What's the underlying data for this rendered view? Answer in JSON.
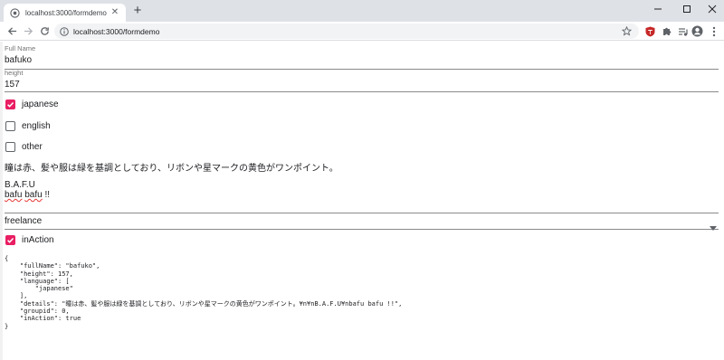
{
  "browser": {
    "tab_title": "localhost:3000/formdemo",
    "url": "localhost:3000/formdemo"
  },
  "form": {
    "full_name": {
      "label": "Full Name",
      "value": "bafuko"
    },
    "height": {
      "label": "height",
      "value": "157"
    },
    "languages": [
      {
        "label": "japanese",
        "checked": true
      },
      {
        "label": "english",
        "checked": false
      },
      {
        "label": "other",
        "checked": false
      }
    ],
    "details_line1": "瞳は赤、髪や服は緑を基調としており、リボンや星マークの黄色がワンポイント。",
    "details_line2": "B.A.F.U",
    "details_word1": "bafu",
    "details_word2": "bafu",
    "details_tail": "!!",
    "group_select": {
      "value": "freelance"
    },
    "in_action": {
      "label": "inAction",
      "checked": true
    }
  },
  "json_output": "{\n    \"fullName\": \"bafuko\",\n    \"height\": 157,\n    \"language\": [\n        \"japanese\"\n    ],\n    \"details\": \"瞳は赤、髪や服は緑を基調としており、リボンや星マークの黄色がワンポイント。¥n¥nB.A.F.U¥nbafu bafu !!\",\n    \"groupid\": 0,\n    \"inAction\": true\n}",
  "colors": {
    "accent": "#e91e63",
    "tabstrip": "#dee1e6",
    "omnibox": "#f1f3f4"
  }
}
